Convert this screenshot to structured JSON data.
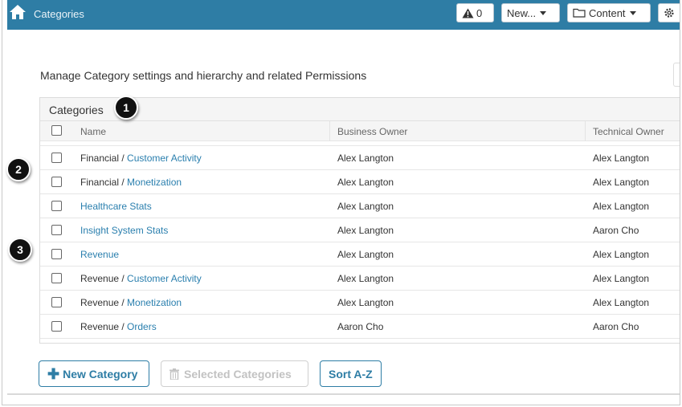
{
  "topbar": {
    "title": "Categories",
    "alerts_count": "0",
    "new_label": "New...",
    "content_label": "Content"
  },
  "description": "Manage Category settings and hierarchy and related Permissions",
  "panel": {
    "title": "Categories",
    "columns": {
      "name": "Name",
      "business_owner": "Business Owner",
      "technical_owner": "Technical Owner"
    }
  },
  "rows": [
    {
      "prefix": "Financial / ",
      "name": "Customer Activity",
      "business_owner": "Alex Langton",
      "technical_owner": "Alex Langton"
    },
    {
      "prefix": "Financial / ",
      "name": "Monetization",
      "business_owner": "Alex Langton",
      "technical_owner": "Alex Langton"
    },
    {
      "prefix": "",
      "name": "Healthcare Stats",
      "business_owner": "Alex Langton",
      "technical_owner": "Alex Langton"
    },
    {
      "prefix": "",
      "name": "Insight System Stats",
      "business_owner": "Alex Langton",
      "technical_owner": "Aaron Cho"
    },
    {
      "prefix": "",
      "name": "Revenue",
      "business_owner": "Alex Langton",
      "technical_owner": "Alex Langton"
    },
    {
      "prefix": "Revenue / ",
      "name": "Customer Activity",
      "business_owner": "Alex Langton",
      "technical_owner": "Alex Langton"
    },
    {
      "prefix": "Revenue / ",
      "name": "Monetization",
      "business_owner": "Alex Langton",
      "technical_owner": "Alex Langton"
    },
    {
      "prefix": "Revenue / ",
      "name": "Orders",
      "business_owner": "Aaron Cho",
      "technical_owner": "Aaron Cho"
    }
  ],
  "callouts": [
    "1",
    "2",
    "3"
  ],
  "buttons": {
    "new_category": "New Category",
    "selected_categories": "Selected Categories",
    "sort": "Sort A-Z"
  },
  "colors": {
    "header_bar": "#2e7da5",
    "link": "#2a7fae"
  }
}
